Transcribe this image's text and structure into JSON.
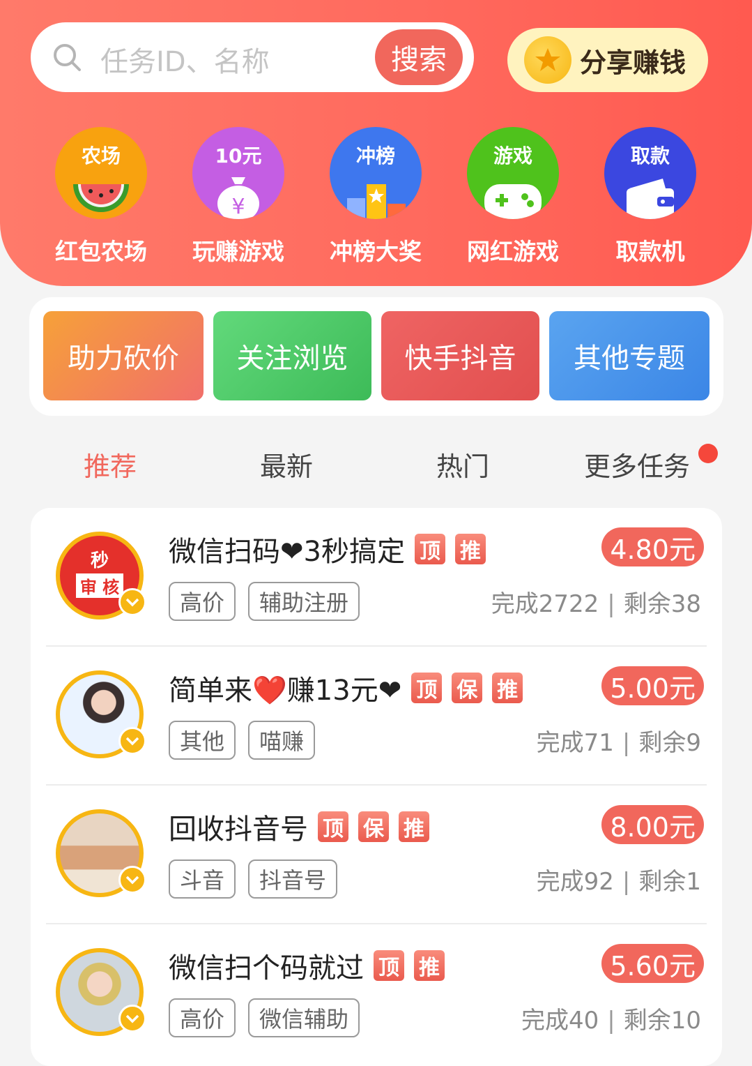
{
  "search": {
    "placeholder": "任务ID、名称",
    "button": "搜索"
  },
  "share": {
    "label": "分享赚钱"
  },
  "quick_links": [
    {
      "top": "农场",
      "label": "红包农场",
      "icon": "watermelon-icon",
      "color": "#f8a20f"
    },
    {
      "top": "10元",
      "label": "玩赚游戏",
      "icon": "money-bag-icon",
      "color": "#c45ee3"
    },
    {
      "top": "冲榜",
      "label": "冲榜大奖",
      "icon": "podium-icon",
      "color": "#3e77ee"
    },
    {
      "top": "游戏",
      "label": "网红游戏",
      "icon": "gamepad-icon",
      "color": "#4fc21c"
    },
    {
      "top": "取款",
      "label": "取款机",
      "icon": "wallet-icon",
      "color": "#3b47e0"
    }
  ],
  "categories": [
    {
      "label": "助力砍价",
      "from": "#f6a139",
      "to": "#f16f6a"
    },
    {
      "label": "关注浏览",
      "from": "#62d97b",
      "to": "#3dbb58"
    },
    {
      "label": "快手抖音",
      "from": "#ef6463",
      "to": "#e14f4f"
    },
    {
      "label": "其他专题",
      "from": "#5aa4f0",
      "to": "#3b86e6"
    }
  ],
  "tabs": [
    {
      "label": "推荐",
      "active": true
    },
    {
      "label": "最新",
      "active": false
    },
    {
      "label": "热门",
      "active": false
    },
    {
      "label": "更多任务",
      "active": false,
      "dot": true
    }
  ],
  "tasks": [
    {
      "title": "微信扫码❤3秒搞定",
      "badges": [
        "顶",
        "推"
      ],
      "tags": [
        "高价",
        "辅助注册"
      ],
      "price": "4.80元",
      "done": "完成2722",
      "left": "剩余38",
      "avatar": "秒审核"
    },
    {
      "title": "简单来❤️赚13元❤",
      "badges": [
        "顶",
        "保",
        "推"
      ],
      "tags": [
        "其他",
        "喵赚"
      ],
      "price": "5.00元",
      "done": "完成71",
      "left": "剩余9",
      "avatar": "photo"
    },
    {
      "title": "回收抖音号",
      "badges": [
        "顶",
        "保",
        "推"
      ],
      "tags": [
        "斗音",
        "抖音号"
      ],
      "price": "8.00元",
      "done": "完成92",
      "left": "剩余1",
      "avatar": "photo"
    },
    {
      "title": "微信扫个码就过",
      "badges": [
        "顶",
        "推"
      ],
      "tags": [
        "高价",
        "微信辅助"
      ],
      "price": "5.60元",
      "done": "完成40",
      "left": "剩余10",
      "avatar": "photo"
    }
  ]
}
